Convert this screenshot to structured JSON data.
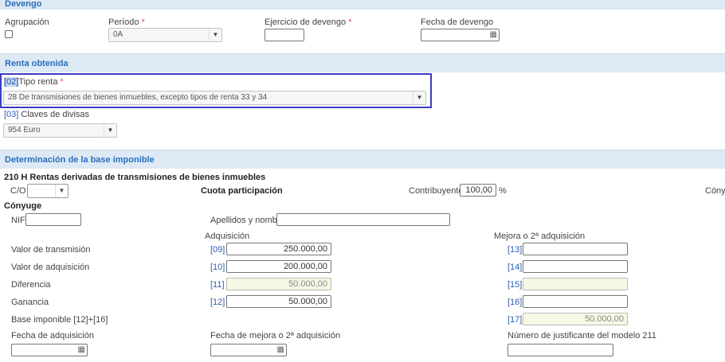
{
  "devengo": {
    "header": "Devengo",
    "agrupacion_label": "Agrupación",
    "periodo_label": "Período",
    "periodo_value": "0A",
    "ejercicio_label": "Ejercicio de devengo",
    "ejercicio_value": "",
    "fecha_label": "Fecha de devengo",
    "fecha_value": "",
    "required_mark": "*"
  },
  "renta": {
    "header": "Renta obtenida",
    "tipo_code": "[02]",
    "tipo_label": "Tipo renta",
    "tipo_value": "28 De transmisiones de bienes inmuebles, excepto tipos de renta 33 y 34",
    "divisas_code": "[03]",
    "divisas_label": "Claves de divisas",
    "divisas_value": "954 Euro"
  },
  "base": {
    "header": "Determinación de la base imponible",
    "subtitle": "210 H Rentas derivadas de transmisiones de bienes inmuebles",
    "co_label": "C/O",
    "co_value": "",
    "cuota_label": "Cuota participación",
    "contribuyente_label": "Contribuyente",
    "contribuyente_value": "100,00",
    "percent": "%",
    "conyuge_trunc": "Cóny",
    "conyuge_heading": "Cónyuge",
    "nif_label": "NIF",
    "nif_value": "",
    "apellidos_label": "Apellidos y nombre",
    "apellidos_value": "",
    "col_adquisicion": "Adquisición",
    "col_mejora": "Mejora o 2ª adquisición",
    "rows": [
      {
        "label": "Valor de transmisión",
        "code_a": "[09]",
        "value_a": "250.000,00",
        "code_b": "[13]",
        "value_b": ""
      },
      {
        "label": "Valor de adquisición",
        "code_a": "[10]",
        "value_a": "200.000,00",
        "code_b": "[14]",
        "value_b": ""
      },
      {
        "label": "Diferencia",
        "code_a": "[11]",
        "value_a": "50.000,00",
        "code_b": "[15]",
        "value_b": ""
      },
      {
        "label": "Ganancia",
        "code_a": "[12]",
        "value_a": "50.000,00",
        "code_b": "[16]",
        "value_b": ""
      },
      {
        "label": "Base imponible [12]+[16]",
        "code_b": "[17]",
        "value_b": "50.000,00"
      }
    ],
    "fecha_adq_label": "Fecha de adquisición",
    "fecha_adq_value": "",
    "fecha_mejora_label": "Fecha de mejora o 2ª adquisición",
    "fecha_mejora_value": "",
    "justificante_label": "Número de justificante del modelo 211",
    "justificante_value": ""
  }
}
